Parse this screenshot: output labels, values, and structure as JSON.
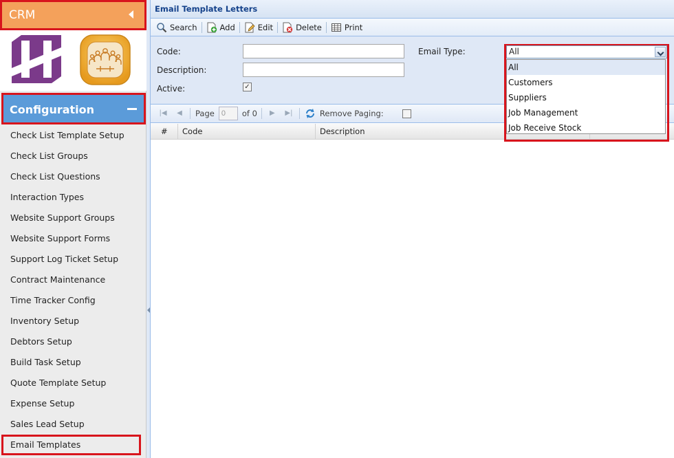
{
  "sidebar": {
    "app_title": "CRM",
    "section_title": "Configuration",
    "items": [
      {
        "label": "Check List Template Setup"
      },
      {
        "label": "Check List Groups"
      },
      {
        "label": "Check List Questions"
      },
      {
        "label": "Interaction Types"
      },
      {
        "label": "Website Support Groups"
      },
      {
        "label": "Website Support Forms"
      },
      {
        "label": "Support Log Ticket Setup"
      },
      {
        "label": "Contract Maintenance"
      },
      {
        "label": "Time Tracker Config"
      },
      {
        "label": "Inventory Setup"
      },
      {
        "label": "Debtors Setup"
      },
      {
        "label": "Build Task Setup"
      },
      {
        "label": "Quote Template Setup"
      },
      {
        "label": "Expense Setup"
      },
      {
        "label": "Sales Lead Setup"
      },
      {
        "label": "Email Templates"
      }
    ],
    "active_item": "Email Templates"
  },
  "panel": {
    "title": "Email Template Letters"
  },
  "toolbar": {
    "search_label": "Search",
    "add_label": "Add",
    "edit_label": "Edit",
    "delete_label": "Delete",
    "print_label": "Print"
  },
  "form": {
    "code_label": "Code:",
    "code_value": "",
    "description_label": "Description:",
    "description_value": "",
    "active_label": "Active:",
    "active_checked": true,
    "email_type_label": "Email Type:",
    "email_type_value": "All"
  },
  "email_type_options": [
    "All",
    "Customers",
    "Suppliers",
    "Job Management",
    "Job Receive Stock"
  ],
  "paging": {
    "page_label": "Page",
    "page_value": "0",
    "of_label": "of 0",
    "remove_paging_label": "Remove Paging:"
  },
  "grid": {
    "columns": [
      "#",
      "Code",
      "Description"
    ]
  },
  "colors": {
    "crm_header": "#f4a15b",
    "config_header": "#5b9bd9",
    "highlight_border": "#d8141c",
    "panel_bg": "#dfe8f6"
  }
}
